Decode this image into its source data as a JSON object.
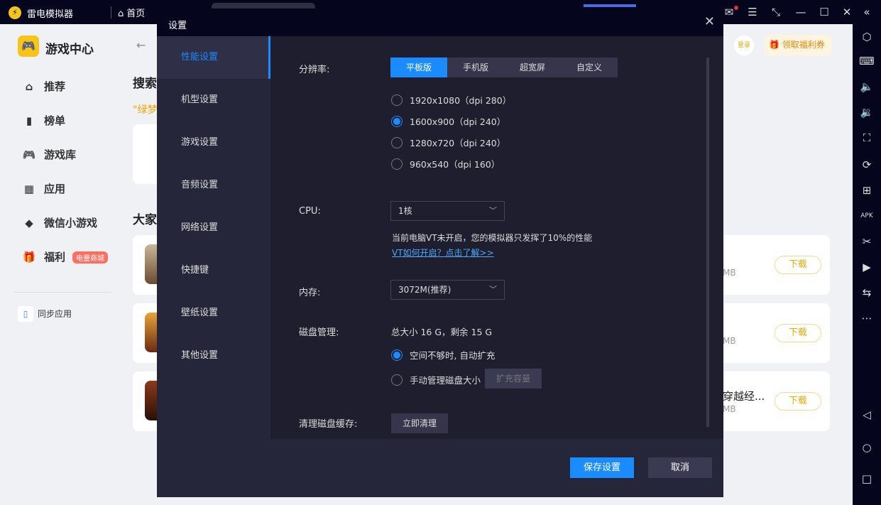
{
  "topbar": {
    "app_title": "雷电模拟器",
    "home_label": "首页"
  },
  "sidebar": {
    "title": "游戏中心",
    "items": [
      {
        "label": "推荐",
        "icon": "house-icon"
      },
      {
        "label": "榜单",
        "icon": "chart-icon"
      },
      {
        "label": "游戏库",
        "icon": "gamepad-icon"
      },
      {
        "label": "应用",
        "icon": "apps-icon"
      },
      {
        "label": "微信小游戏",
        "icon": "diamond-icon"
      },
      {
        "label": "福利",
        "icon": "gift-icon",
        "badge": "电量商城"
      }
    ],
    "sync_label": "同步应用"
  },
  "main": {
    "search_heading": "搜索",
    "search_hint": "\"绿梦",
    "popular_heading": "大家",
    "login_label": "登录",
    "coupon_label": "领取福利券",
    "cards": [
      {
        "title": "",
        "size": "MB",
        "button": "下载"
      },
      {
        "title": "",
        "size": "MB",
        "button": "下载"
      },
      {
        "title": "穿越经...",
        "size": "MB",
        "button": "下载"
      }
    ]
  },
  "dialog": {
    "title": "设置",
    "nav": [
      "性能设置",
      "机型设置",
      "游戏设置",
      "音频设置",
      "网络设置",
      "快捷键",
      "壁纸设置",
      "其他设置"
    ],
    "resolution": {
      "label": "分辨率:",
      "tabs": [
        "平板版",
        "手机版",
        "超宽屏",
        "自定义"
      ],
      "selected_tab": 0,
      "options": [
        "1920x1080（dpi 280）",
        "1600x900（dpi 240）",
        "1280x720（dpi 240）",
        "960x540（dpi 160）"
      ],
      "selected_option": 1
    },
    "cpu": {
      "label": "CPU:",
      "value": "1核",
      "warning": "当前电脑VT未开启，您的模拟器只发挥了10%的性能",
      "link": "VT如何开启？点击了解>>"
    },
    "memory": {
      "label": "内存:",
      "value": "3072M(推荐)"
    },
    "disk": {
      "label": "磁盘管理:",
      "summary": "总大小 16 G，剩余 15 G",
      "auto_option": "空间不够时, 自动扩充",
      "manual_option": "手动管理磁盘大小",
      "expand_button": "扩充容量"
    },
    "cache": {
      "label": "清理磁盘缓存:",
      "button": "立即清理"
    },
    "save_button": "保存设置",
    "cancel_button": "取消"
  },
  "colors": {
    "accent": "#1a8cff",
    "dark": "#05061e",
    "panel": "#1e1e2e"
  }
}
